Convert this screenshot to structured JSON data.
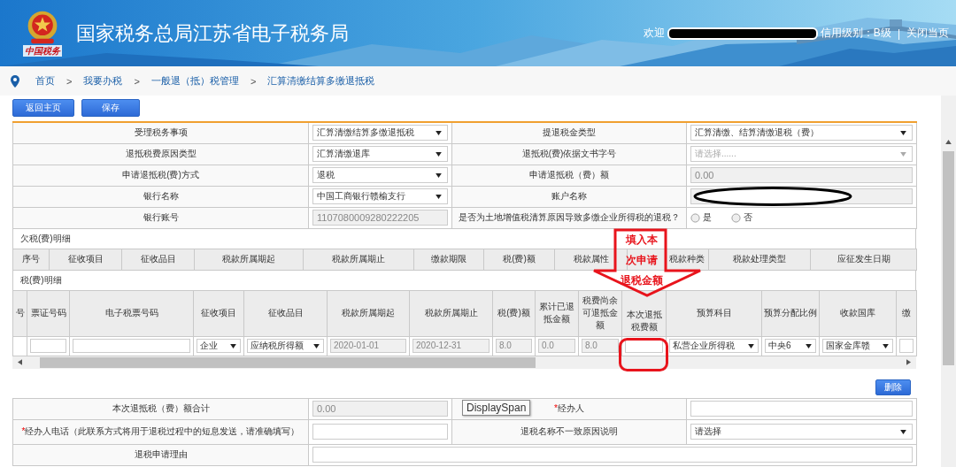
{
  "header": {
    "title": "国家税务总局江苏省电子税务局",
    "logo_text": "中国税务",
    "welcome": "欢迎",
    "name_redacted": true,
    "credit": "信用级别：B级",
    "separator": "|",
    "close": "关闭当页"
  },
  "breadcrumb": [
    {
      "label": "首页"
    },
    {
      "sep": ">",
      "label": "我要办税"
    },
    {
      "sep": ">",
      "label": "一般退（抵）税管理"
    },
    {
      "sep": ">",
      "label": "汇算清缴结算多缴退抵税"
    }
  ],
  "toolbar": [
    "返回主页",
    "保存"
  ],
  "form": {
    "rows": [
      {
        "cells": [
          {
            "kind": "label",
            "text": "受理税务事项"
          },
          {
            "kind": "select",
            "value": "汇算清缴结算多缴退抵税"
          },
          {
            "kind": "label",
            "text": "提退税金类型"
          },
          {
            "kind": "select",
            "value": "汇算清缴、结算清缴退税（费）"
          }
        ]
      },
      {
        "cells": [
          {
            "kind": "label",
            "text": "退抵税费原因类型"
          },
          {
            "kind": "select",
            "value": "汇算清缴退库"
          },
          {
            "kind": "label",
            "text": "退抵税(费)依据文书字号"
          },
          {
            "kind": "select",
            "placeholder": "请选择......"
          }
        ]
      },
      {
        "cells": [
          {
            "kind": "label",
            "text": "申请退抵税(费)方式"
          },
          {
            "kind": "select",
            "value": "退税"
          },
          {
            "kind": "label",
            "text": "申请退抵税（费）额"
          },
          {
            "kind": "input",
            "value": "0.00",
            "disabled": true
          }
        ]
      },
      {
        "cells": [
          {
            "kind": "label",
            "text": "银行名称"
          },
          {
            "kind": "select",
            "value": "中国工商银行赣榆支行"
          },
          {
            "kind": "label",
            "text": "账户名称"
          },
          {
            "kind": "input",
            "disabled": true,
            "redacted": true
          }
        ]
      },
      {
        "cells": [
          {
            "kind": "label",
            "text": "银行账号"
          },
          {
            "kind": "input",
            "value": "1107080009280222205",
            "disabled": true
          },
          {
            "kind": "label",
            "text": "是否为土地增值税清算原因导致多缴企业所得税的退税？"
          },
          {
            "kind": "radios",
            "options": [
              {
                "label": "是",
                "selected": false
              },
              {
                "label": "否",
                "selected": false
              }
            ]
          }
        ]
      }
    ]
  },
  "arrears": {
    "title": "欠税(费)明细",
    "columns": [
      "序号",
      "征收项目",
      "征收品目",
      "税款所属期起",
      "税款所属期止",
      "缴款期限",
      "税(费)额",
      "税款属性",
      "税款种类",
      "税款处理类型",
      "应征发生日期"
    ]
  },
  "refunds": {
    "title": "税(费)明细",
    "columns": [
      "号",
      "票证号码",
      "电子税票号码",
      "征收项目",
      "征收品目",
      "税款所属期起",
      "税款所属期止",
      "税(费)额",
      "累计已退抵金额",
      "税费尚余可退抵金额",
      "本次退抵税费额",
      "预算科目",
      "预算分配比例",
      "收款国库",
      "缴"
    ],
    "rows": [
      {
        "cells": [
          {
            "kind": "blank"
          },
          {
            "kind": "input"
          },
          {
            "kind": "input"
          },
          {
            "kind": "select",
            "value": "企业"
          },
          {
            "kind": "select",
            "value": "应纳税所得额"
          },
          {
            "kind": "input",
            "value": "2020-01-01",
            "disabled": true
          },
          {
            "kind": "input",
            "value": "2020-12-31",
            "disabled": true
          },
          {
            "kind": "input",
            "value": "8.0",
            "disabled": true
          },
          {
            "kind": "input",
            "value": "0.0",
            "disabled": true
          },
          {
            "kind": "input",
            "value": "8.0",
            "disabled": true
          },
          {
            "kind": "input"
          },
          {
            "kind": "select",
            "value": "私营企业所得税"
          },
          {
            "kind": "select",
            "value": "中央6"
          },
          {
            "kind": "select",
            "value": "国家金库赣"
          },
          {
            "kind": "input"
          }
        ]
      }
    ]
  },
  "delete_button": "删除",
  "summary": {
    "rows": [
      {
        "cells": [
          {
            "kind": "label",
            "text": "本次退抵税（费）额合计"
          },
          {
            "kind": "input",
            "value": "0.00",
            "disabled": true
          },
          {
            "kind": "label",
            "text": "经办人",
            "required_mark": "*"
          },
          {
            "kind": "input"
          }
        ]
      },
      {
        "cells": [
          {
            "kind": "label",
            "text": "经办人电话（此联系方式将用于退税过程中的短息发送，请准确填写）",
            "required_mark": "*"
          },
          {
            "kind": "input"
          },
          {
            "kind": "label",
            "text": "退税名称不一致原因说明"
          },
          {
            "kind": "select",
            "value": "请选择"
          }
        ]
      },
      {
        "cells": [
          {
            "kind": "label",
            "text": "退税申请理由"
          },
          {
            "kind": "input"
          }
        ]
      }
    ]
  },
  "tooltip": "DisplaySpan",
  "annotation": {
    "lines": [
      "填入本",
      "次申请",
      "退税金额"
    ]
  }
}
